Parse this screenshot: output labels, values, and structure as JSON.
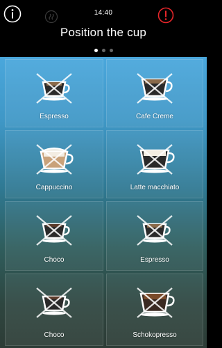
{
  "status_bar": {
    "time": "14:40",
    "icons": [
      "info-icon",
      "steam-icon",
      "alert-icon"
    ],
    "alert_color": "#e8262a"
  },
  "header": {
    "prompt": "Position the cup"
  },
  "pager": {
    "page_count": 3,
    "active_page": 1
  },
  "products": [
    {
      "label": "Espresso",
      "icon": "espresso-cup-icon",
      "disabled": true
    },
    {
      "label": "Cafe Creme",
      "icon": "cafe-creme-cup-icon",
      "disabled": true
    },
    {
      "label": "Cappuccino",
      "icon": "cappuccino-cup-icon",
      "disabled": true
    },
    {
      "label": "Latte macchiato",
      "icon": "latte-macchiato-glass-icon",
      "disabled": true
    },
    {
      "label": "Choco",
      "icon": "choco-cup-icon",
      "disabled": true
    },
    {
      "label": "Espresso",
      "icon": "espresso-cup-icon",
      "disabled": true
    },
    {
      "label": "Choco",
      "icon": "choco-cup-icon",
      "disabled": true
    },
    {
      "label": "Schokopresso",
      "icon": "schokopresso-cup-icon",
      "disabled": true
    }
  ]
}
